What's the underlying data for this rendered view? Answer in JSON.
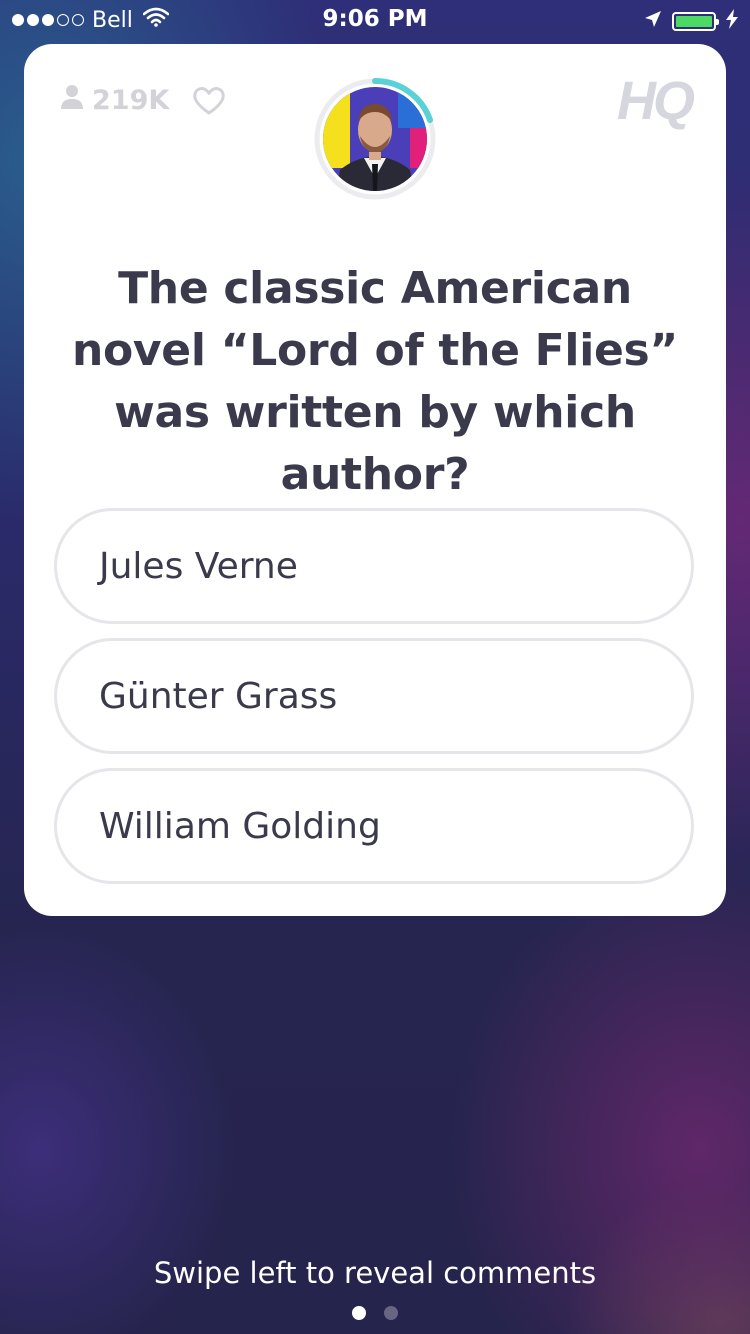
{
  "status_bar": {
    "carrier": "Bell",
    "time": "9:06 PM",
    "signal_bars_filled": 3,
    "signal_bars_total": 5,
    "battery_color": "#4cd964",
    "icons": [
      "wifi-icon",
      "location-arrow-icon",
      "battery-icon",
      "charging-bolt-icon"
    ]
  },
  "card": {
    "viewer_count": "219K",
    "logo_text": "HQ",
    "icons": [
      "person-icon",
      "heart-icon",
      "host-avatar"
    ],
    "timer_color": "#5ad1d6",
    "question": "The classic American novel “Lord of the Flies” was written by which author?",
    "answers": [
      {
        "label": "Jules Verne"
      },
      {
        "label": "Günter Grass"
      },
      {
        "label": "William Golding"
      }
    ]
  },
  "footer": {
    "hint": "Swipe left to reveal comments",
    "page_count": 2,
    "active_page": 1
  }
}
